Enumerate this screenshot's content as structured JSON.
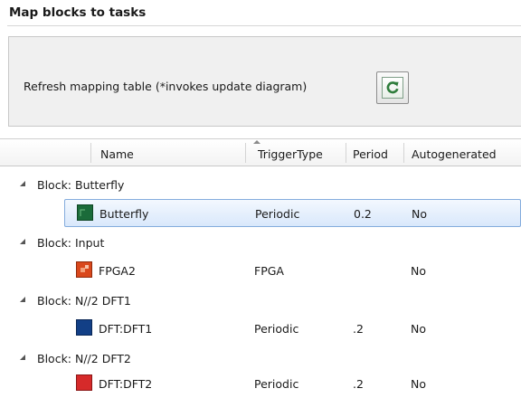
{
  "heading": "Map blocks to tasks",
  "refresh": {
    "label": "Refresh mapping table (*invokes update diagram)",
    "button_icon": "refresh-icon"
  },
  "columns": {
    "name": "Name",
    "trigger_type": "TriggerType",
    "period": "Period",
    "autogenerated": "Autogenerated"
  },
  "sort": {
    "column": "Name",
    "direction": "ascending"
  },
  "groups": [
    {
      "label": "Block: Butterfly",
      "expanded": true,
      "task": {
        "name": "Butterfly",
        "trigger_type": "Periodic",
        "period": "0.2",
        "autogenerated": "No",
        "icon_color": "#1b6b3a",
        "selected": true
      }
    },
    {
      "label": "Block: Input",
      "expanded": true,
      "task": {
        "name": "FPGA2",
        "trigger_type": "FPGA",
        "period": "",
        "autogenerated": "No",
        "icon_color": "#d9481c",
        "selected": false
      }
    },
    {
      "label": "Block: N//2 DFT1",
      "expanded": true,
      "task": {
        "name": "DFT:DFT1",
        "trigger_type": "Periodic",
        "period": ".2",
        "autogenerated": "No",
        "icon_color": "#123f86",
        "selected": false
      }
    },
    {
      "label": "Block: N//2 DFT2",
      "expanded": true,
      "task": {
        "name": "DFT:DFT2",
        "trigger_type": "Periodic",
        "period": ".2",
        "autogenerated": "No",
        "icon_color": "#d62a2a",
        "selected": false
      }
    }
  ],
  "colors": {
    "selection_fill": "#d9e8fb",
    "selection_border": "#84acdd",
    "panel_bg": "#f0f0f0"
  }
}
